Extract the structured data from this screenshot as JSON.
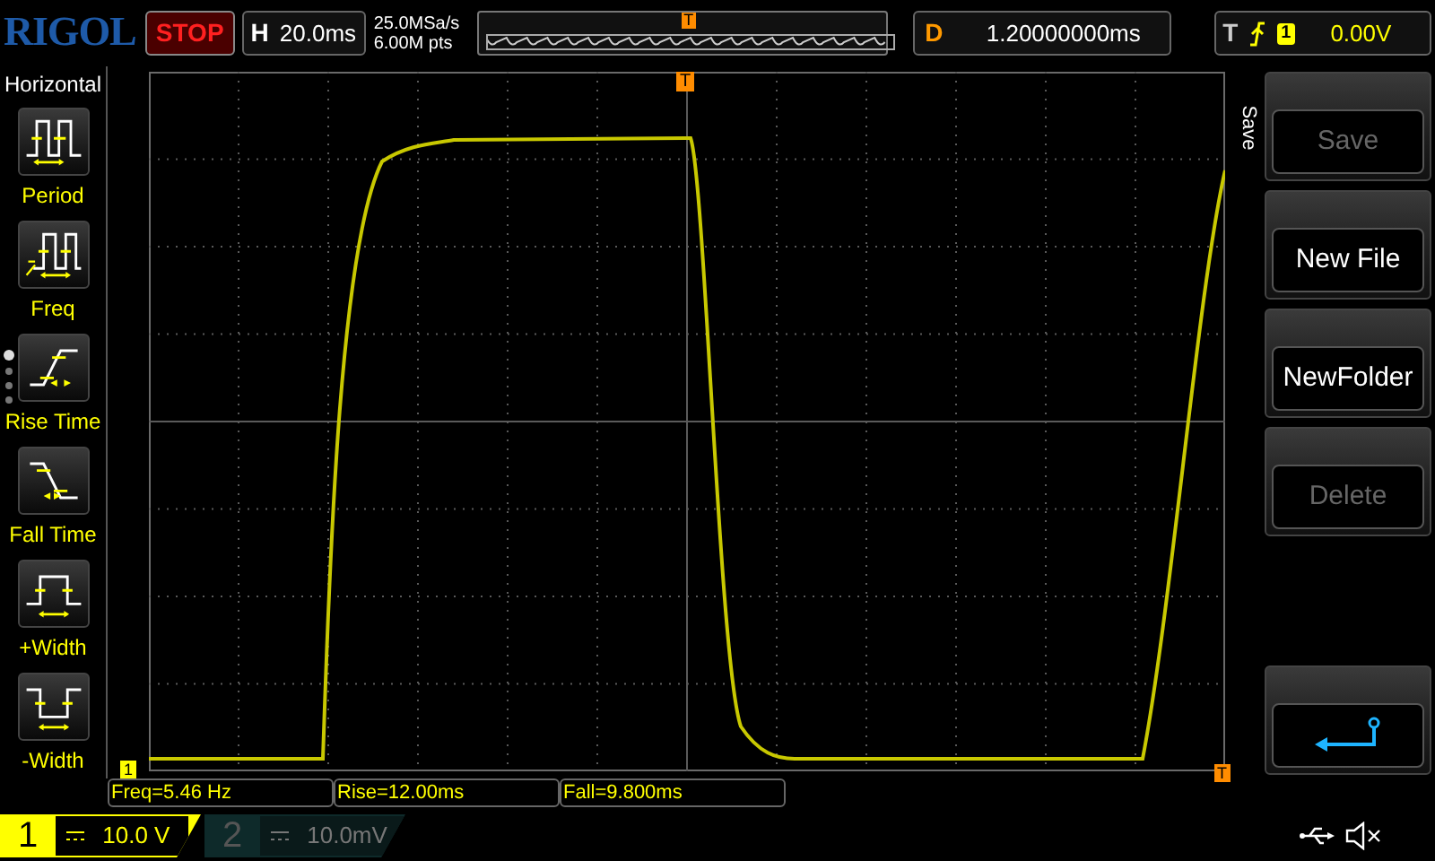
{
  "brand": {
    "logo": "RIGOL"
  },
  "run_state": {
    "label": "STOP"
  },
  "timebase": {
    "key": "H",
    "value": "20.0ms"
  },
  "acquisition": {
    "sample_rate": "25.0MSa/s",
    "memory_depth": "6.00M pts",
    "trigger_marker": "T"
  },
  "delay": {
    "key": "D",
    "value": "1.20000000ms"
  },
  "trigger": {
    "key": "T",
    "source": "1",
    "level_reading": "0.00V"
  },
  "menu": {
    "title": "Horizontal",
    "items": [
      {
        "label": "Period",
        "kind": "period"
      },
      {
        "label": "Freq",
        "kind": "freq"
      },
      {
        "label": "Rise Time",
        "kind": "rise"
      },
      {
        "label": "Fall Time",
        "kind": "fall"
      },
      {
        "label": "+Width",
        "kind": "pwidth"
      },
      {
        "label": "-Width",
        "kind": "nwidth"
      }
    ],
    "pages": [
      {
        "selected": true
      },
      {
        "selected": false
      },
      {
        "selected": false
      },
      {
        "selected": false
      }
    ]
  },
  "screen": {
    "trigger_marker": "T",
    "channel_marker": "1",
    "trigger_level_marker": "T"
  },
  "measurements": [
    "Freq=5.46 Hz",
    "Rise=12.00ms",
    "Fall=9.800ms"
  ],
  "channels": [
    {
      "number": "1",
      "scale": "10.0 V",
      "selected": true
    },
    {
      "number": "2",
      "scale": "10.0mV",
      "selected": false
    }
  ],
  "softkeys": {
    "title": "Save",
    "buttons": [
      {
        "kind": "text",
        "label": "Save",
        "disabled": true
      },
      {
        "kind": "text",
        "label": "New File",
        "disabled": false
      },
      {
        "kind": "text",
        "label": "NewFolder",
        "disabled": false
      },
      {
        "kind": "text",
        "label": "Delete",
        "disabled": true
      },
      {
        "kind": "return",
        "disabled": false
      }
    ]
  }
}
